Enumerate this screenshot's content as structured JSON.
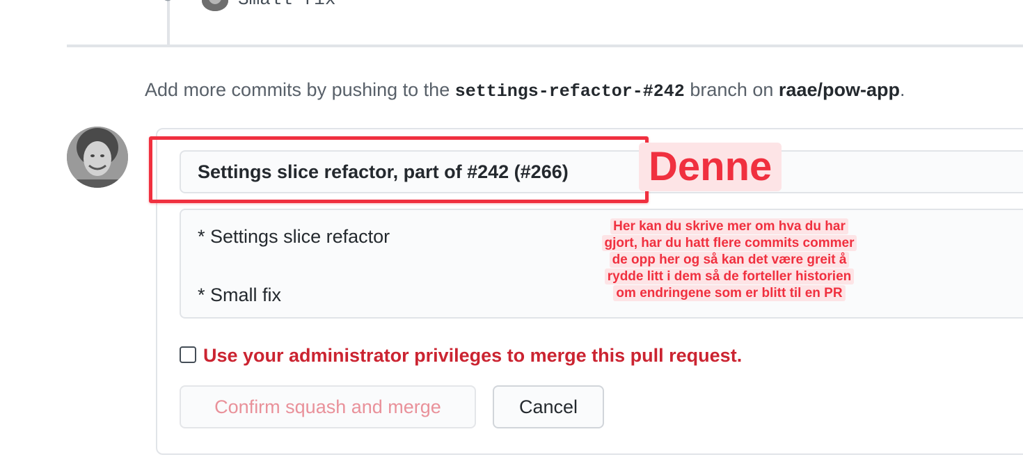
{
  "timeline": {
    "top_commit_message": "Small fix"
  },
  "hint": {
    "prefix": "Add more commits by pushing to the",
    "branch": "settings-refactor-#242",
    "middle": "branch on",
    "repo": "raae/pow-app",
    "suffix": "."
  },
  "merge_form": {
    "commit_title": "Settings slice refactor, part of #242 (#266)",
    "commit_body_lines": [
      "* Settings slice refactor",
      "* Small fix"
    ],
    "admin_checkbox": {
      "checked": false,
      "label": "Use your administrator privileges to merge this pull request."
    },
    "confirm_button": "Confirm squash and merge",
    "cancel_button": "Cancel"
  },
  "annotations": {
    "title_label": "Denne",
    "note_lines": [
      "Her kan du skrive mer om hva du har",
      "gjort, har du hatt flere commits commer",
      "de opp her og så kan det være greit å",
      "rydde litt i dem så de forteller historien",
      "om endringene som er blitt til en PR"
    ]
  },
  "colors": {
    "annotation": "#f0303f",
    "danger_text": "#cb2431",
    "disabled_confirm_text": "#e9919a"
  }
}
